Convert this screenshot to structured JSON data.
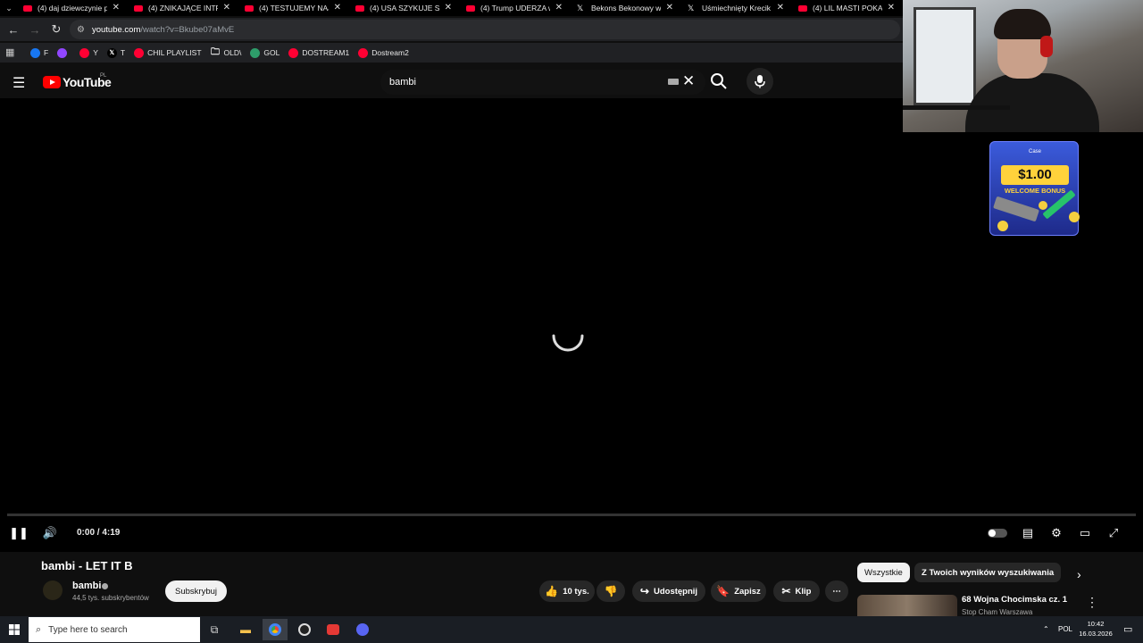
{
  "browser": {
    "tabs": [
      {
        "label": "(4) daj dziewczynie p",
        "favicon": "youtube-icon"
      },
      {
        "label": "(4) ZNIKAJĄCE INTRA",
        "favicon": "youtube-icon"
      },
      {
        "label": "(4) TESTUJEMY NAJB",
        "favicon": "youtube-icon"
      },
      {
        "label": "(4) USA SZYKUJE SIĘ",
        "favicon": "youtube-icon"
      },
      {
        "label": "(4) Trump UDERZA w",
        "favicon": "youtube-icon"
      },
      {
        "label": "Bekons Bekonowy w",
        "favicon": "x-icon"
      },
      {
        "label": "Uśmiechnięty Krecik",
        "favicon": "x-icon"
      },
      {
        "label": "(4) LIL MASTI POKAZ",
        "favicon": "youtube-icon"
      }
    ],
    "address": {
      "host": "youtube.com",
      "path": "/watch?v=Bkube07aMvE"
    },
    "bookmarks": [
      {
        "label": "F",
        "icon": "facebook-icon",
        "color": "#1877f2"
      },
      {
        "label": "",
        "icon": "twitch-icon",
        "color": "#9146ff"
      },
      {
        "label": "Y",
        "icon": "youtube-icon",
        "color": "#ff0033"
      },
      {
        "label": "T",
        "icon": "x-icon",
        "color": "#000000"
      },
      {
        "label": "CHIL PLAYLIST",
        "icon": "youtube-icon",
        "color": "#ff0033"
      },
      {
        "label": "OLD\\",
        "icon": "folder-icon",
        "color": "#202124"
      },
      {
        "label": "GOL",
        "icon": "gol-icon",
        "color": "#2e9d6a"
      },
      {
        "label": "DOSTREAM1",
        "icon": "youtube-icon",
        "color": "#ff0033"
      },
      {
        "label": "Dostream2",
        "icon": "youtube-icon",
        "color": "#ff0033"
      }
    ]
  },
  "youtube": {
    "logo_text": "YouTube",
    "region": "PL",
    "search_value": "bambi"
  },
  "player": {
    "time": "0:00 / 4:19",
    "progress": 0
  },
  "video": {
    "title": "bambi - LET IT B",
    "channel": "bambi",
    "subscribers": "44,5 tys. subskrybentów",
    "subscribe_label": "Subskrybuj",
    "likes": "10 tys.",
    "share_label": "Udostępnij",
    "save_label": "Zapisz",
    "clip_label": "Klip"
  },
  "sidebar": {
    "chips": [
      "Wszystkie",
      "Z Twoich wyników wyszukiwania"
    ],
    "recommendation": {
      "title": "68 Wojna Chocimska cz. 1",
      "channel": "Stop Cham Warszawa"
    }
  },
  "ad": {
    "brand": "Case",
    "amount": "$1.00",
    "bonus": "WELCOME BONUS"
  },
  "taskbar": {
    "search_placeholder": "Type here to search",
    "language": "POL",
    "time": "10:42",
    "date": "16.03.2026"
  },
  "colors": {
    "accent": "#ff0000",
    "background": "#0f0f0f",
    "pill": "#272727"
  }
}
